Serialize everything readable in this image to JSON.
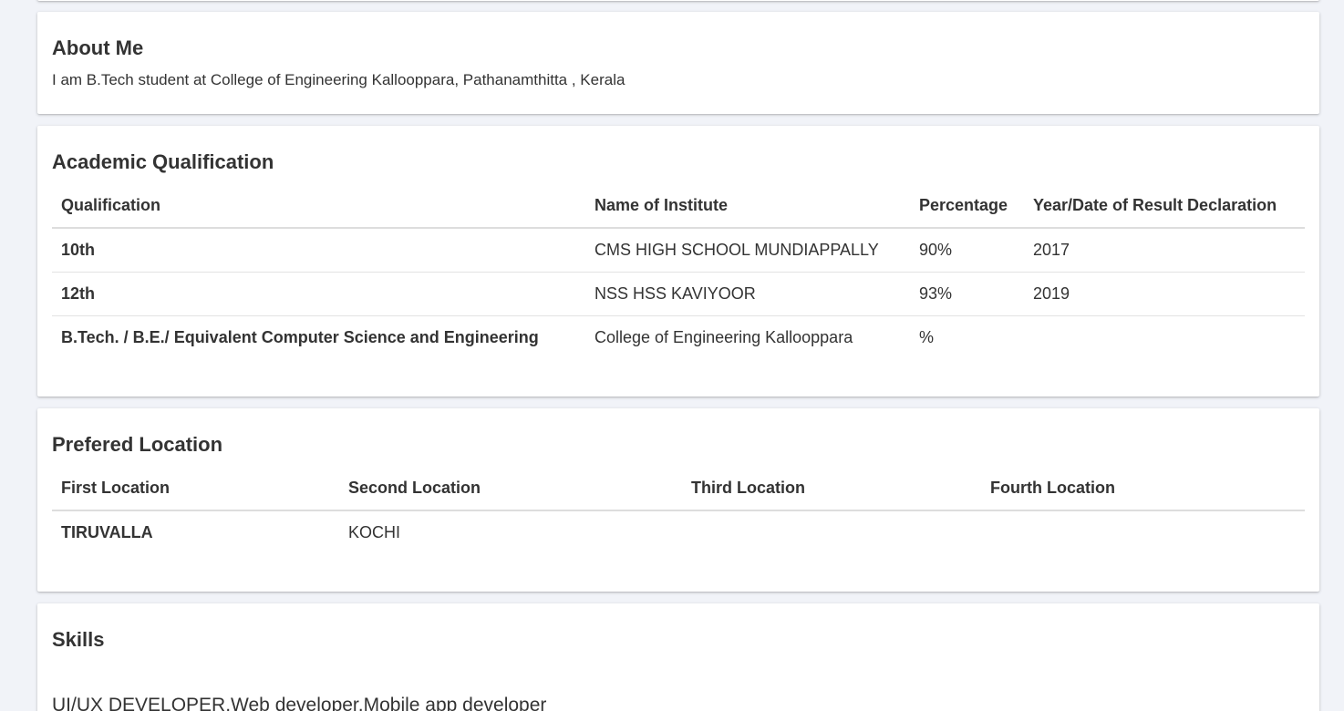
{
  "about": {
    "title": "About Me",
    "text": "I am B.Tech student at College of Engineering Kallooppara, Pathanamthitta , Kerala"
  },
  "academic": {
    "title": "Academic Qualification",
    "headers": [
      "Qualification",
      "Name of Institute",
      "Percentage",
      "Year/Date of Result Declaration"
    ],
    "rows": [
      [
        "10th",
        "CMS HIGH SCHOOL MUNDIAPPALLY",
        "90%",
        "2017"
      ],
      [
        "12th",
        "NSS HSS KAVIYOOR",
        "93%",
        "2019"
      ],
      [
        "B.Tech. / B.E./ Equivalent Computer Science and Engineering",
        "College of Engineering Kallooppara",
        "%",
        ""
      ]
    ]
  },
  "location": {
    "title": "Prefered Location",
    "headers": [
      "First Location",
      "Second Location",
      "Third Location",
      "Fourth Location"
    ],
    "rows": [
      [
        "TIRUVALLA",
        "KOCHI",
        "",
        ""
      ]
    ]
  },
  "skills": {
    "title": "Skills",
    "text": "UI/UX DEVELOPER,Web developer,Mobile app developer"
  }
}
